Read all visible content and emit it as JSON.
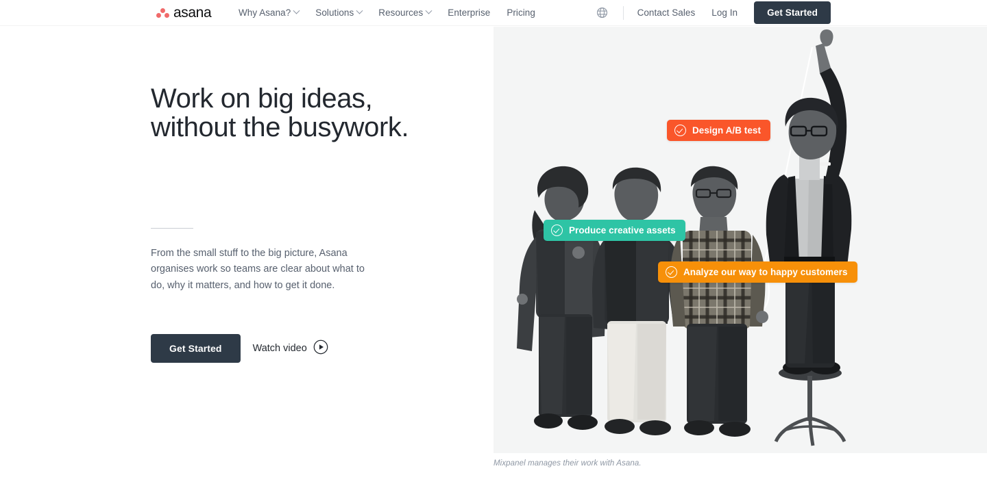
{
  "header": {
    "logo": {
      "word": "asana",
      "icon": "asana-dots-logo",
      "dot_color": "#f06a6a"
    },
    "nav": [
      {
        "label": "Why Asana?",
        "has_dropdown": true
      },
      {
        "label": "Solutions",
        "has_dropdown": true
      },
      {
        "label": "Resources",
        "has_dropdown": true
      },
      {
        "label": "Enterprise",
        "has_dropdown": false
      },
      {
        "label": "Pricing",
        "has_dropdown": false
      }
    ],
    "language_icon": "globe-icon",
    "contact_sales": "Contact Sales",
    "log_in": "Log In",
    "get_started": "Get Started"
  },
  "hero": {
    "headline_line1": "Work on big ideas,",
    "headline_line2": "without the busywork.",
    "subcopy": "From the small stuff to the big picture, Asana organises work so teams are clear about what to do, why it matters, and how to get it done.",
    "cta_primary": "Get Started",
    "cta_secondary": "Watch video",
    "play_icon": "play-circle-icon"
  },
  "image_panel": {
    "caption": "Mixpanel manages their work with Asana.",
    "badges": [
      {
        "label": "Design A/B test",
        "color": "#fa562a",
        "icon": "check-circle-icon"
      },
      {
        "label": "Produce creative assets",
        "color": "#2ec4a5",
        "icon": "check-circle-icon"
      },
      {
        "label": "Analyze our way to happy customers",
        "color": "#f79009",
        "icon": "check-circle-icon"
      }
    ]
  },
  "colors": {
    "dark_navy": "#2e3a47",
    "text_body": "#57606e",
    "headline": "#23282f",
    "panel_bg": "#f4f5f5"
  }
}
